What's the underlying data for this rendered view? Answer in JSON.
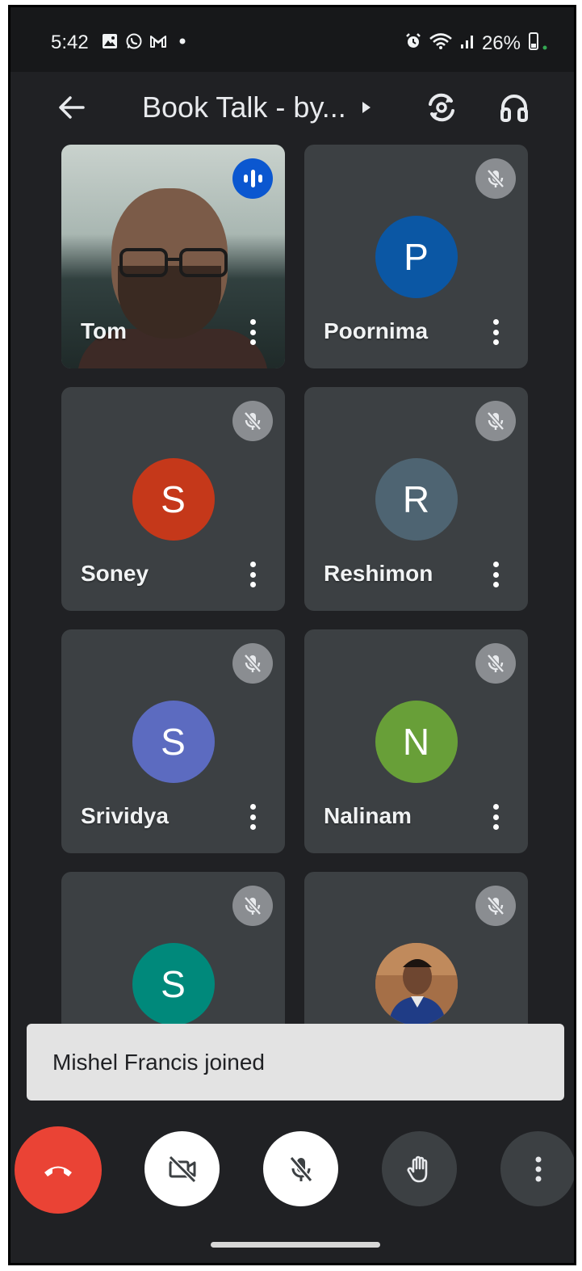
{
  "status_bar": {
    "time": "5:42",
    "notification_icons": [
      "gallery-icon",
      "whatsapp-icon",
      "gmail-icon",
      "dot-icon"
    ],
    "system_icons": [
      "alarm-icon",
      "wifi-icon",
      "signal-icon"
    ],
    "battery": "26%"
  },
  "app_bar": {
    "title": "Book Talk - by...",
    "back_icon": "arrow-back-icon",
    "switch_camera_icon": "flip-camera-icon",
    "audio_icon": "headphones-icon"
  },
  "participants": [
    {
      "name": "Tom",
      "type": "video",
      "speaking": true
    },
    {
      "name": "Poornima",
      "initial": "P",
      "color": "#0b57a4",
      "muted": true
    },
    {
      "name": "Soney",
      "initial": "S",
      "color": "#c5381a",
      "muted": true
    },
    {
      "name": "Reshimon",
      "initial": "R",
      "color": "#4e6472",
      "muted": true
    },
    {
      "name": "Srividya",
      "initial": "S",
      "color": "#5c6bc0",
      "muted": true
    },
    {
      "name": "Nalinam",
      "initial": "N",
      "color": "#689f38",
      "muted": true
    },
    {
      "name": "",
      "initial": "S",
      "color": "#00897b",
      "muted": true
    },
    {
      "name": "",
      "type": "photo",
      "muted": true
    }
  ],
  "toast": {
    "message": "Mishel Francis joined"
  },
  "controls": {
    "end_call_icon": "end-call-icon",
    "camera_icon": "camera-off-icon",
    "mic_icon": "mic-off-icon",
    "raise_hand_icon": "raise-hand-icon",
    "more_icon": "more-vert-icon"
  },
  "colors": {
    "background": "#202124",
    "tile": "#3c4043",
    "end_call": "#ea4335",
    "speaking": "#0b57d0"
  }
}
